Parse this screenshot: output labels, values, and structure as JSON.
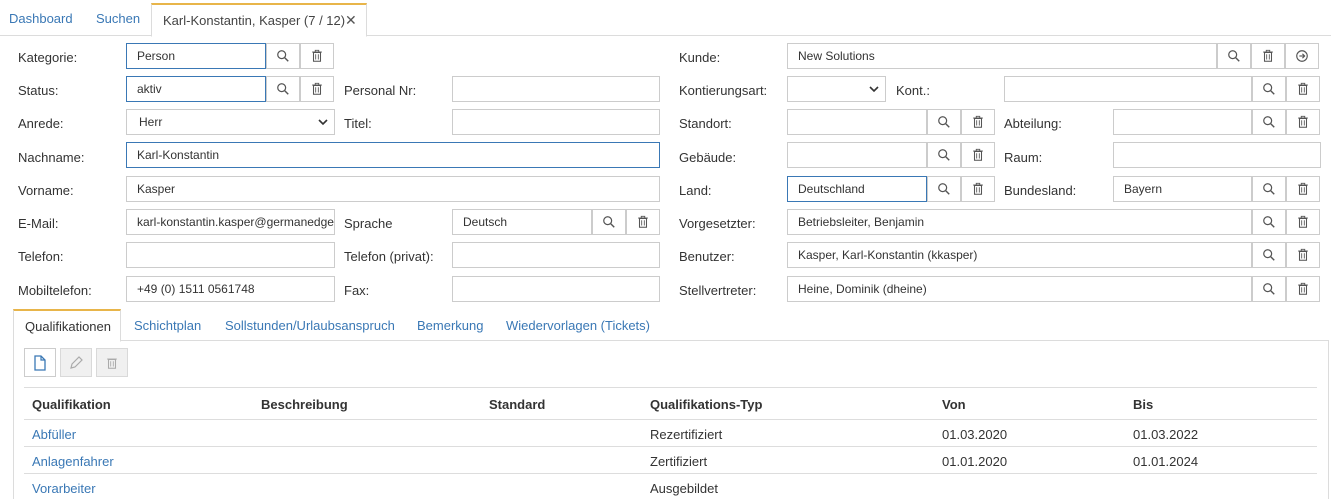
{
  "nav": {
    "dashboard": "Dashboard",
    "search": "Suchen",
    "active_tab": "Karl-Konstantin, Kasper (7 / 12)",
    "close": "✕"
  },
  "form": {
    "kategorie": {
      "label": "Kategorie:",
      "value": "Person"
    },
    "status": {
      "label": "Status:",
      "value": "aktiv"
    },
    "anrede": {
      "label": "Anrede:",
      "value": "Herr"
    },
    "nachname": {
      "label": "Nachname:",
      "value": "Karl-Konstantin"
    },
    "vorname": {
      "label": "Vorname:",
      "value": "Kasper"
    },
    "email": {
      "label": "E-Mail:",
      "value": "karl-konstantin.kasper@germanedge"
    },
    "telefon": {
      "label": "Telefon:",
      "value": ""
    },
    "mobil": {
      "label": "Mobiltelefon:",
      "value": "+49 (0) 1511 0561748"
    },
    "personalnr": {
      "label": "Personal Nr:",
      "value": ""
    },
    "titel": {
      "label": "Titel:",
      "value": ""
    },
    "sprache": {
      "label": "Sprache",
      "value": "Deutsch"
    },
    "telefon_privat": {
      "label": "Telefon (privat):",
      "value": ""
    },
    "fax": {
      "label": "Fax:",
      "value": ""
    },
    "kunde": {
      "label": "Kunde:",
      "value": "New Solutions"
    },
    "kontierungsart": {
      "label": "Kontierungsart:",
      "value": ""
    },
    "kont": {
      "label": "Kont.:",
      "value": ""
    },
    "standort": {
      "label": "Standort:",
      "value": ""
    },
    "abteilung": {
      "label": "Abteilung:",
      "value": ""
    },
    "gebaeude": {
      "label": "Gebäude:",
      "value": ""
    },
    "raum": {
      "label": "Raum:",
      "value": ""
    },
    "land": {
      "label": "Land:",
      "value": "Deutschland"
    },
    "bundesland": {
      "label": "Bundesland:",
      "value": "Bayern"
    },
    "vorgesetzter": {
      "label": "Vorgesetzter:",
      "value": "Betriebsleiter, Benjamin"
    },
    "benutzer": {
      "label": "Benutzer:",
      "value": "Kasper, Karl-Konstantin (kkasper)"
    },
    "stellvertreter": {
      "label": "Stellvertreter:",
      "value": "Heine, Dominik (dheine)"
    }
  },
  "tabs": [
    "Qualifikationen",
    "Schichtplan",
    "Sollstunden/Urlaubsanspruch",
    "Bemerkung",
    "Wiedervorlagen (Tickets)"
  ],
  "table": {
    "headers": [
      "Qualifikation",
      "Beschreibung",
      "Standard",
      "Qualifikations-Typ",
      "Von",
      "Bis"
    ],
    "rows": [
      {
        "q": "Abfüller",
        "b": "",
        "s": "",
        "t": "Rezertifiziert",
        "von": "01.03.2020",
        "bis": "01.03.2022"
      },
      {
        "q": "Anlagenfahrer",
        "b": "",
        "s": "",
        "t": "Zertifiziert",
        "von": "01.01.2020",
        "bis": "01.01.2024"
      },
      {
        "q": "Vorarbeiter",
        "b": "",
        "s": "",
        "t": "Ausgebildet",
        "von": "",
        "bis": ""
      }
    ]
  },
  "colors": {
    "link": "#3a78b5",
    "accent": "#e8b54a",
    "border": "#cccccc"
  }
}
